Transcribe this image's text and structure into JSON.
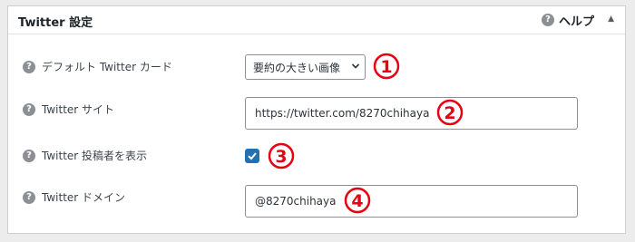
{
  "panel": {
    "title": "Twitter 設定",
    "help_label": "ヘルプ",
    "collapse_glyph": "▲"
  },
  "rows": {
    "card": {
      "label": "デフォルト Twitter カード",
      "value": "要約の大きい画像"
    },
    "site": {
      "label": "Twitter サイト",
      "value": "https://twitter.com/8270chihaya"
    },
    "show_author": {
      "label": "Twitter 投稿者を表示",
      "checked": true
    },
    "domain": {
      "label": "Twitter ドメイン",
      "value": "@8270chihaya"
    }
  },
  "markers": [
    "1",
    "2",
    "3",
    "4"
  ],
  "colors": {
    "accent": "#2271b1",
    "marker": "#e60012"
  }
}
